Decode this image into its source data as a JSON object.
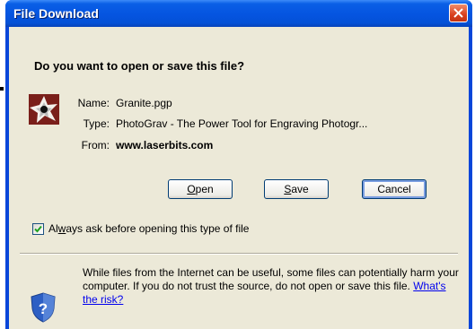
{
  "window": {
    "title": "File Download"
  },
  "dialog": {
    "question": "Do you want to open or save this file?",
    "file_icon": "photograv-file-icon",
    "name_label": "Name:",
    "name_value": "Granite.pgp",
    "type_label": "Type:",
    "type_value": "PhotoGrav - The Power Tool for Engraving Photogr...",
    "from_label": "From:",
    "from_value": "www.laserbits.com"
  },
  "buttons": {
    "open_mnemonic": "O",
    "open_rest": "pen",
    "save_mnemonic": "S",
    "save_rest": "ave",
    "cancel": "Cancel"
  },
  "checkbox": {
    "checked": true,
    "label_prefix": "Al",
    "label_mnemonic": "w",
    "label_rest": "ays ask before opening this type of file"
  },
  "warning": {
    "icon": "shield-question-icon",
    "text": "While files from the Internet can be useful, some files can potentially harm your computer. If you do not trust the source, do not open or save this file.",
    "link": "What's the risk?"
  },
  "colors": {
    "titlebar": "#0554e0",
    "client_background": "#ece9d8",
    "close_button": "#d9401f",
    "link": "#0000ee"
  }
}
